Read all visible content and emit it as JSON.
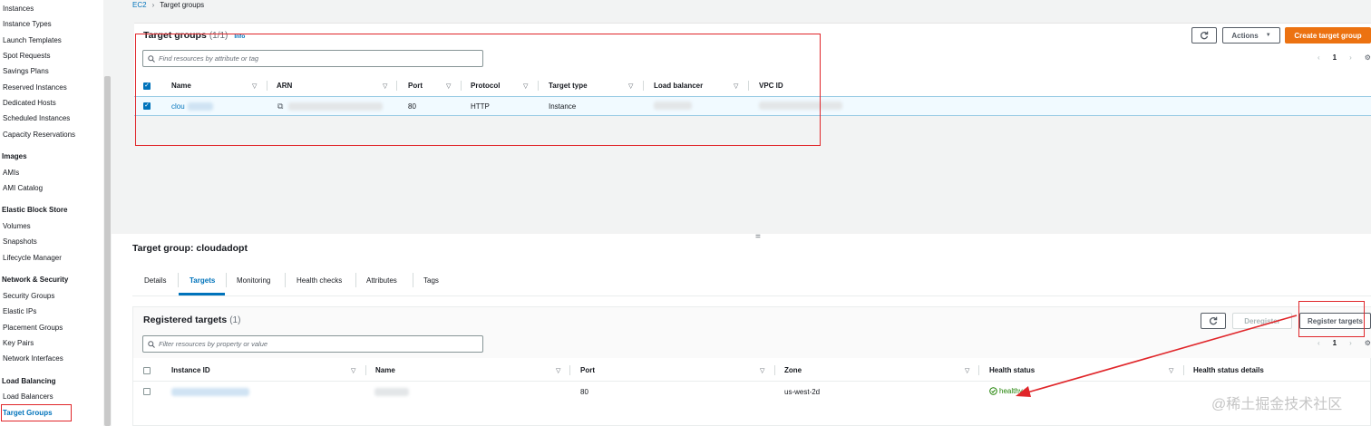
{
  "sidebar": {
    "items": [
      {
        "label": "Instances",
        "type": "item"
      },
      {
        "label": "Instance Types",
        "type": "item"
      },
      {
        "label": "Launch Templates",
        "type": "item"
      },
      {
        "label": "Spot Requests",
        "type": "item"
      },
      {
        "label": "Savings Plans",
        "type": "item"
      },
      {
        "label": "Reserved Instances",
        "type": "item"
      },
      {
        "label": "Dedicated Hosts",
        "type": "item"
      },
      {
        "label": "Scheduled Instances",
        "type": "item"
      },
      {
        "label": "Capacity Reservations",
        "type": "item"
      },
      {
        "label": "Images",
        "type": "header"
      },
      {
        "label": "AMIs",
        "type": "item"
      },
      {
        "label": "AMI Catalog",
        "type": "item"
      },
      {
        "label": "Elastic Block Store",
        "type": "header"
      },
      {
        "label": "Volumes",
        "type": "item"
      },
      {
        "label": "Snapshots",
        "type": "item"
      },
      {
        "label": "Lifecycle Manager",
        "type": "item"
      },
      {
        "label": "Network & Security",
        "type": "header"
      },
      {
        "label": "Security Groups",
        "type": "item"
      },
      {
        "label": "Elastic IPs",
        "type": "item"
      },
      {
        "label": "Placement Groups",
        "type": "item"
      },
      {
        "label": "Key Pairs",
        "type": "item"
      },
      {
        "label": "Network Interfaces",
        "type": "item"
      },
      {
        "label": "Load Balancing",
        "type": "header"
      },
      {
        "label": "Load Balancers",
        "type": "item"
      },
      {
        "label": "Target Groups",
        "type": "item",
        "active": true
      }
    ]
  },
  "breadcrumb": {
    "root": "EC2",
    "separator": "›",
    "current": "Target groups"
  },
  "target_groups": {
    "title": "Target groups",
    "count": "(1/1)",
    "info": "Info",
    "refresh_icon": "refresh-icon",
    "actions_label": "Actions",
    "create_label": "Create target group",
    "search_placeholder": "Find resources by attribute or tag",
    "page": "1",
    "columns": [
      "Name",
      "ARN",
      "Port",
      "Protocol",
      "Target type",
      "Load balancer",
      "VPC ID"
    ],
    "row": {
      "name": "clou",
      "port": "80",
      "protocol": "HTTP",
      "target_type": "Instance"
    }
  },
  "resize_handle": "=",
  "detail": {
    "title": "Target group: cloudadopt",
    "tabs": [
      "Details",
      "Targets",
      "Monitoring",
      "Health checks",
      "Attributes",
      "Tags"
    ],
    "active_tab": "Targets"
  },
  "registered_targets": {
    "title": "Registered targets",
    "count": "(1)",
    "deregister_label": "Deregister",
    "register_label": "Register targets",
    "search_placeholder": "Filter resources by property or value",
    "page": "1",
    "columns": [
      "Instance ID",
      "Name",
      "Port",
      "Zone",
      "Health status",
      "Health status details"
    ],
    "row": {
      "port": "80",
      "zone": "us-west-2d",
      "health_status": "healthy"
    }
  },
  "watermark": "@稀土掘金技术社区",
  "colors": {
    "accent": "#0073bb",
    "primary_button": "#ec7211",
    "annotation": "#e0262a",
    "healthy": "#1d8102"
  }
}
